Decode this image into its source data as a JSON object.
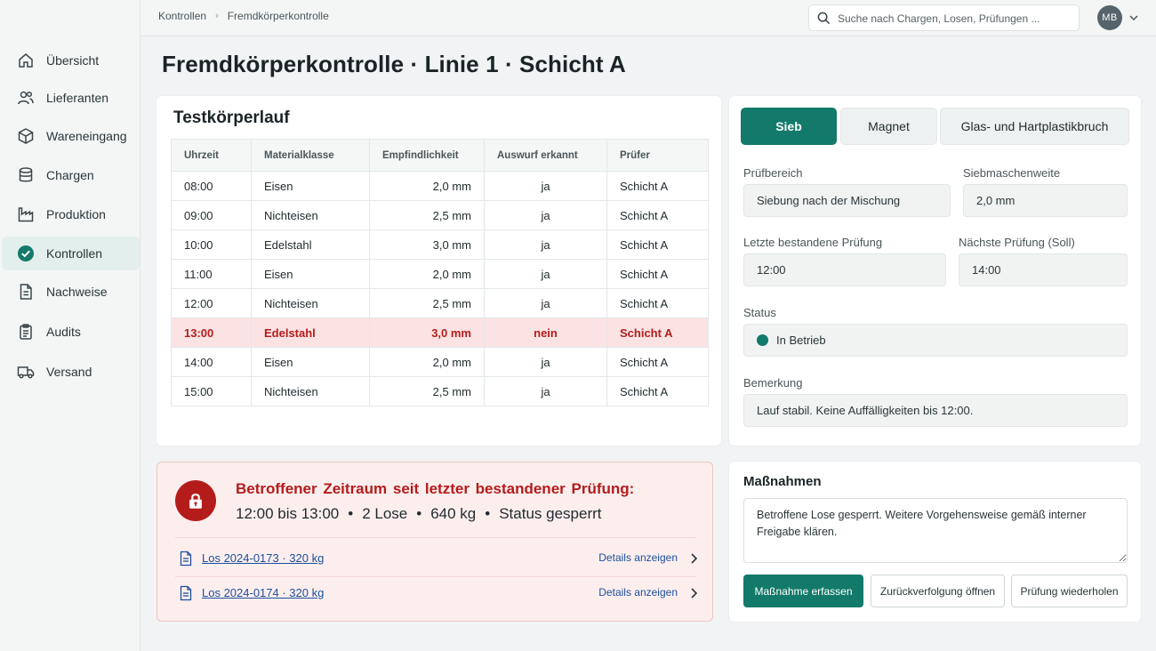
{
  "breadcrumb": {
    "parent": "Kontrollen",
    "current": "Fremdkörperkontrolle"
  },
  "search": {
    "placeholder": "Suche nach Chargen, Losen, Prüfungen ..."
  },
  "user": {
    "initials": "MB"
  },
  "sidebar": {
    "items": [
      {
        "label": "Übersicht",
        "icon": "home-icon"
      },
      {
        "label": "Lieferanten",
        "icon": "users-icon"
      },
      {
        "label": "Wareneingang",
        "icon": "box-icon"
      },
      {
        "label": "Chargen",
        "icon": "database-icon"
      },
      {
        "label": "Produktion",
        "icon": "factory-icon"
      },
      {
        "label": "Kontrollen",
        "icon": "check-circle-icon",
        "active": true
      },
      {
        "label": "Nachweise",
        "icon": "document-icon"
      },
      {
        "label": "Audits",
        "icon": "clipboard-icon"
      },
      {
        "label": "Versand",
        "icon": "truck-icon"
      }
    ]
  },
  "page": {
    "title": "Fremdkörperkontrolle · Linie 1 · Schicht A"
  },
  "testrun": {
    "title": "Testkörperlauf",
    "columns": [
      "Uhrzeit",
      "Materialklasse",
      "Empfindlichkeit",
      "Auswurf erkannt",
      "Prüfer"
    ],
    "rows": [
      {
        "time": "08:00",
        "material": "Eisen",
        "sensitivity": "2,0 mm",
        "detected": "ja",
        "inspector": "Schicht A"
      },
      {
        "time": "09:00",
        "material": "Nichteisen",
        "sensitivity": "2,5 mm",
        "detected": "ja",
        "inspector": "Schicht A"
      },
      {
        "time": "10:00",
        "material": "Edelstahl",
        "sensitivity": "3,0 mm",
        "detected": "ja",
        "inspector": "Schicht A"
      },
      {
        "time": "11:00",
        "material": "Eisen",
        "sensitivity": "2,0 mm",
        "detected": "ja",
        "inspector": "Schicht A"
      },
      {
        "time": "12:00",
        "material": "Nichteisen",
        "sensitivity": "2,5 mm",
        "detected": "ja",
        "inspector": "Schicht A"
      },
      {
        "time": "13:00",
        "material": "Edelstahl",
        "sensitivity": "3,0 mm",
        "detected": "nein",
        "inspector": "Schicht A",
        "failed": true
      },
      {
        "time": "14:00",
        "material": "Eisen",
        "sensitivity": "2,0 mm",
        "detected": "ja",
        "inspector": "Schicht A"
      },
      {
        "time": "15:00",
        "material": "Nichteisen",
        "sensitivity": "2,5 mm",
        "detected": "ja",
        "inspector": "Schicht A"
      }
    ]
  },
  "alert": {
    "heading": "Betroffener Zeitraum seit letzter bestandener Prüfung:",
    "period": "12:00 bis 13:00",
    "lots_count": "2 Lose",
    "weight": "640 kg",
    "status": "Status gesperrt",
    "separator": "•",
    "color": "#b41c1c",
    "lots": [
      {
        "label": "Los 2024-0173  ·  320 kg",
        "action": "Details anzeigen"
      },
      {
        "label": "Los 2024-0174  ·  320 kg",
        "action": "Details anzeigen"
      }
    ]
  },
  "details": {
    "tabs": [
      {
        "label": "Sieb",
        "active": true
      },
      {
        "label": "Magnet"
      },
      {
        "label": "Glas- und Hartplastikbruch"
      }
    ],
    "pruefbereich_label": "Prüfbereich",
    "pruefbereich_value": "Siebung nach der Mischung",
    "maschenweite_label": "Siebmaschenweite",
    "maschenweite_value": "2,0 mm",
    "letzte_label": "Letzte bestandene Prüfung",
    "letzte_value": "12:00",
    "naechste_label": "Nächste Prüfung (Soll)",
    "naechste_value": "14:00",
    "status_label": "Status",
    "status_value": "In Betrieb",
    "status_color": "#137a6b",
    "bemerkung_label": "Bemerkung",
    "bemerkung_value": "Lauf stabil. Keine Auffälligkeiten bis 12:00."
  },
  "actions": {
    "title": "Maßnahmen",
    "text": "Betroffene Lose gesperrt. Weitere Vorgehensweise gemäß interner Freigabe klären.",
    "buttons": {
      "record": "Maßnahme erfassen",
      "trace": "Zurückverfolgung öffnen",
      "repeat": "Prüfung wiederholen"
    }
  },
  "colors": {
    "accent": "#137a6b",
    "danger": "#b41c1c",
    "danger_bg": "#fdeeee"
  }
}
